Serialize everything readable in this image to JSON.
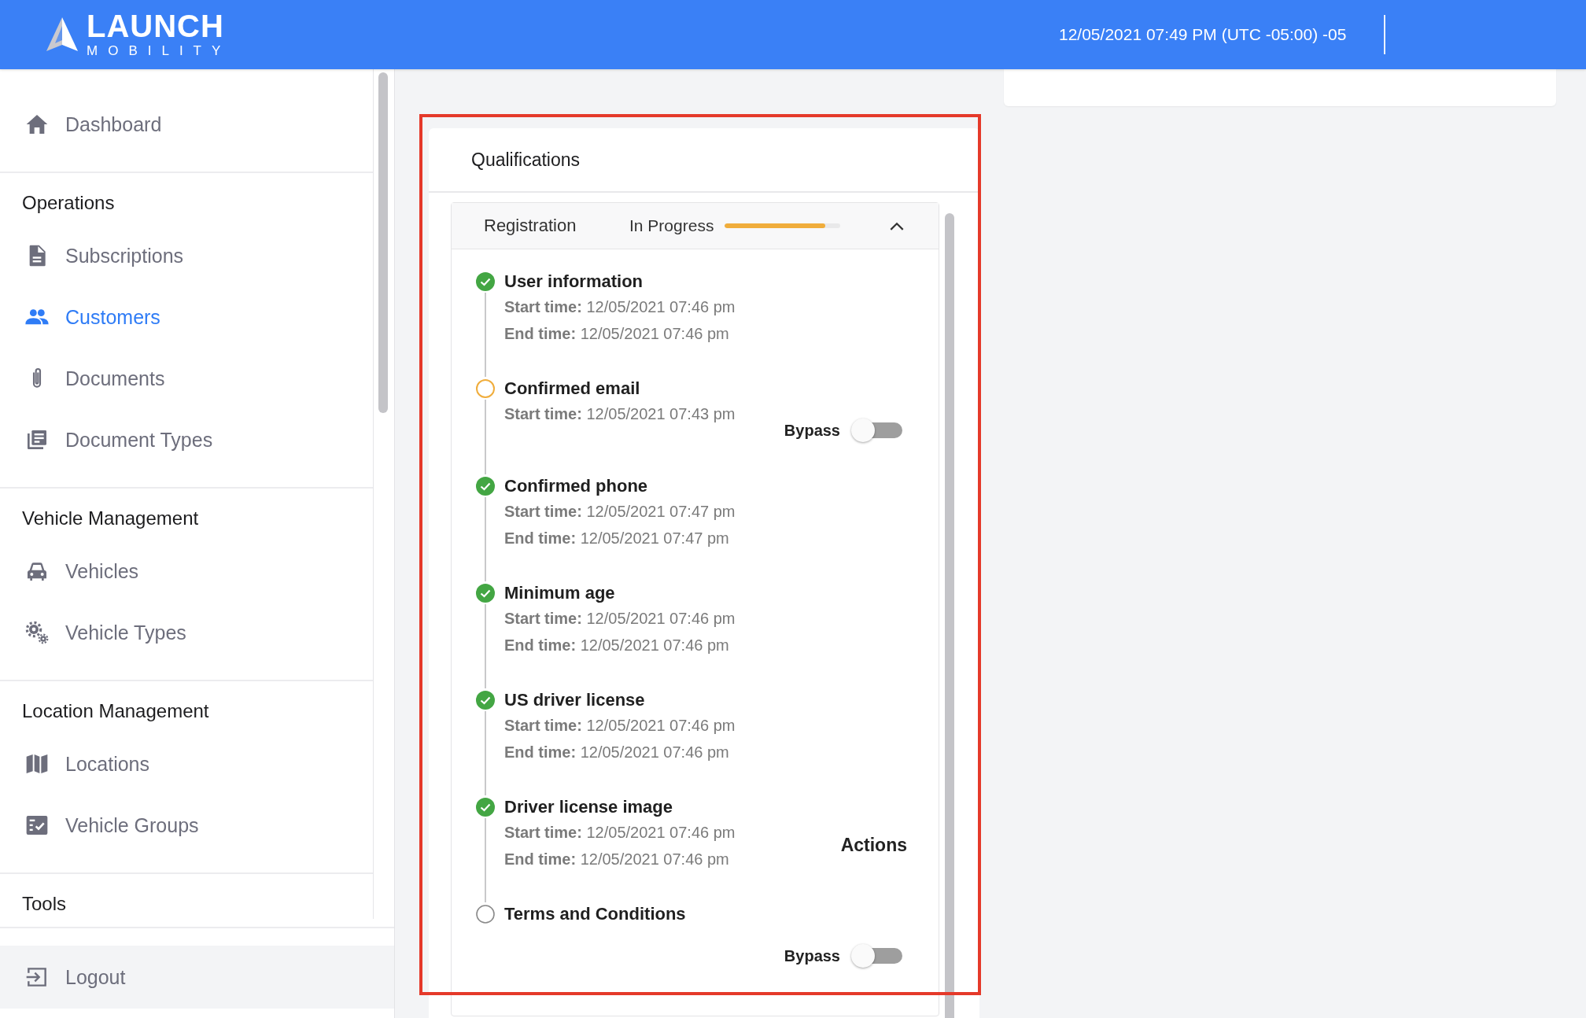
{
  "header": {
    "logo": {
      "name": "LAUNCH",
      "tagline": "MOBILITY"
    },
    "datetime": "12/05/2021 07:49 PM (UTC -05:00) -05"
  },
  "sidebar": {
    "sections": [
      {
        "items": [
          {
            "label": "Dashboard",
            "selected": false
          }
        ]
      },
      {
        "heading": "Operations",
        "items": [
          {
            "label": "Subscriptions",
            "selected": false
          },
          {
            "label": "Customers",
            "selected": true
          },
          {
            "label": "Documents",
            "selected": false
          },
          {
            "label": "Document Types",
            "selected": false
          }
        ]
      },
      {
        "heading": "Vehicle Management",
        "items": [
          {
            "label": "Vehicles",
            "selected": false
          },
          {
            "label": "Vehicle Types",
            "selected": false
          }
        ]
      },
      {
        "heading": "Location Management",
        "items": [
          {
            "label": "Locations",
            "selected": false
          },
          {
            "label": "Vehicle Groups",
            "selected": false
          }
        ]
      },
      {
        "heading": "Tools"
      }
    ],
    "footer": {
      "label": "Logout"
    }
  },
  "qualifications": {
    "title": "Qualifications",
    "group": {
      "name": "Registration",
      "status": "In Progress",
      "level": 0.87,
      "expanded": true,
      "steps": [
        {
          "title": "User information",
          "kind": "done",
          "details": [
            "**Start time:** 12/05/2021 07:46 pm",
            "**End time:** 12/05/2021 07:46 pm"
          ]
        },
        {
          "title": "Confirmed email",
          "kind": "in_progress",
          "details": [
            "**Start time:** 12/05/2021 07:43 pm"
          ],
          "bypass": {
            "label": "Bypass",
            "on": false
          }
        },
        {
          "title": "Confirmed phone",
          "kind": "done",
          "details": [
            "**Start time:** 12/05/2021 07:47 pm",
            "**End time:** 12/05/2021 07:47 pm"
          ]
        },
        {
          "title": "Minimum age",
          "kind": "done",
          "details": [
            "**Start time:** 12/05/2021 07:46 pm",
            "**End time:** 12/05/2021 07:46 pm"
          ]
        },
        {
          "title": "US driver license",
          "kind": "done",
          "details": [
            "**Start time:** 12/05/2021 07:46 pm",
            "**End time:** 12/05/2021 07:46 pm"
          ]
        },
        {
          "title": "Driver license image",
          "kind": "done",
          "details": [
            "**Start time:** 12/05/2021 07:46 pm",
            "**End time:** 12/05/2021 07:46 pm"
          ],
          "actions": "Actions"
        },
        {
          "title": "Terms and Conditions",
          "kind": "pending",
          "bypass": {
            "label": "Bypass",
            "on": false
          }
        }
      ]
    }
  }
}
